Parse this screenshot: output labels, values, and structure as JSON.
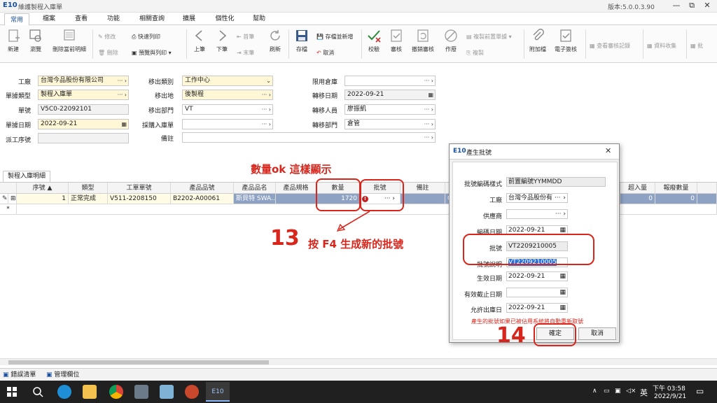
{
  "titlebar": {
    "logo": "E10",
    "title": "維護製程入庫單",
    "version": "版本:5.0.0.3.90",
    "min_icon": "—",
    "restore_icon": "⧉",
    "close_icon": "✕"
  },
  "menu": [
    "常用",
    "檔案",
    "查看",
    "功能",
    "相關查詢",
    "擴展",
    "個性化",
    "幫助"
  ],
  "ribbon": {
    "new": "新建",
    "browse": "瀏覽",
    "delete_detail": "刪除當前明細",
    "modify": "修改",
    "delete": "刪除",
    "quick_print": "快速列印",
    "preview_print": "預覽與列印",
    "prev": "上筆",
    "next": "下筆",
    "first": "首筆",
    "last": "末筆",
    "refresh": "刷新",
    "save": "存檔",
    "save_new": "存檔並新增",
    "cancel": "取消",
    "verify": "校驗",
    "approve": "審核",
    "unapprove": "撤銷審核",
    "void": "作廢",
    "copy_prev": "複製前置單據",
    "copy": "複製",
    "attachment": "附加檔",
    "esign": "電子簽核",
    "view_approval": "查看審核記錄",
    "data_collect": "資料收集",
    "batch": "批"
  },
  "form": {
    "factory_label": "工廠",
    "factory_value": "台灣今品股份有限公司",
    "doctype_label": "單據類型",
    "doctype_value": "製程入庫單",
    "docno_label": "單號",
    "docno_value": "V5C0-22092101",
    "docdate_label": "單據日期",
    "docdate_value": "2022-09-21",
    "dispatch_label": "派工序號",
    "dispatch_value": "",
    "movetype_label": "移出類別",
    "movetype_value": "工作中心",
    "movefrom_label": "移出地",
    "movefrom_value": "後製程",
    "movedept_label": "移出部門",
    "movedept_value": "VT",
    "purchase_label": "採購入庫單",
    "purchase_value": "",
    "remark_label": "備註",
    "remark_value": "",
    "limitwh_label": "限用倉庫",
    "limitwh_value": "",
    "transdate_label": "轉移日期",
    "transdate_value": "2022-09-21",
    "transperson_label": "轉移人員",
    "transperson_value": "廖振凱",
    "transdept_label": "轉移部門",
    "transdept_value": "倉管",
    "dots": "···",
    "arrow": "›",
    "dropdown": "⌄"
  },
  "grid": {
    "tab": "製程入庫明細",
    "headers": [
      "序號",
      "類型",
      "工單單號",
      "產品品號",
      "產品品名",
      "產品規格",
      "數量",
      "批號",
      "備註",
      "超入量",
      "報廢數量"
    ],
    "row": {
      "seq": "1",
      "type": "正常完成",
      "workorder": "V511-2208150",
      "item": "B2202-A00061",
      "name": "斯貝特 SWA…",
      "spec": "",
      "qty": "1720",
      "lot_icon": "!",
      "lot": "···",
      "remark": "",
      "zero_col": "0",
      "over": "0",
      "scrap": "0"
    },
    "edit_marker": "✎",
    "new_marker": "*"
  },
  "annotations": {
    "qty_note": "數量ok 這樣顯示",
    "step13": "13",
    "step13_text": "按 F4 生成新的批號",
    "step14": "14"
  },
  "dialog": {
    "logo": "E10",
    "title": "產生批號",
    "close": "✕",
    "rule_label": "批號編碼樣式",
    "rule_value": "前置編號YYMMDD",
    "factory_label": "工廠",
    "factory_value": "台灣今品股份有 ···",
    "supplier_label": "供應商",
    "supplier_value": "",
    "codedate_label": "編碼日期",
    "codedate_value": "2022-09-21",
    "lot_label": "批號",
    "lot_value": "VT2209210005",
    "lotdesc_label": "批號說明",
    "lotdesc_value": "VT2209210005",
    "effdate_label": "生效日期",
    "effdate_value": "2022-09-21",
    "expdate_label": "有效截止日期",
    "expdate_value": "",
    "allowout_label": "允許出庫日",
    "allowout_value": "2022-09-21",
    "warning": "產生的批號如果已被佔用系統將自動重新取號",
    "ok": "確定",
    "cancel": "取消"
  },
  "bottom_tabs": [
    "錯誤清單",
    "管理欄位"
  ],
  "taskbar": {
    "time": "下午 03:58",
    "date": "2022/9/21",
    "ime": "英"
  },
  "colors": {
    "accent": "#1a4f9c",
    "required": "#fff7d6",
    "selected_row": "#8ea3c4",
    "annotation": "#d9261c",
    "taskbar": "#202020"
  }
}
